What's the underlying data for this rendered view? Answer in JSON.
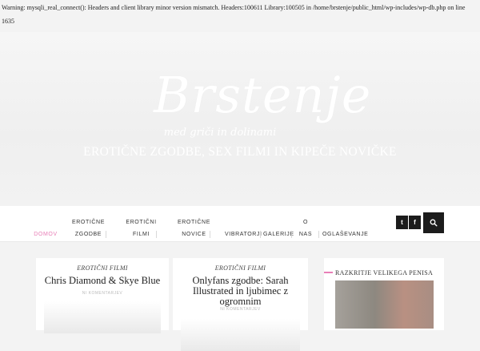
{
  "warning_text": "Warning: mysqli_real_connect(): Headers and client library minor version mismatch. Headers:100611 Library:100505 in /home/brstenje/public_html/wp-includes/wp-db.php on line 1635",
  "site": {
    "logo": "Brstenje",
    "tagline_script": "med griči in dolinami",
    "tagline": "EROTIČNE ZGODBE, SEX FILMI IN KIPEČE NOVIČKE"
  },
  "nav": {
    "items": [
      {
        "line1": "DOMOV",
        "line2": ""
      },
      {
        "line1": "EROTIČNE",
        "line2": "ZGODBE"
      },
      {
        "line1": "EROTIČNI",
        "line2": "FILMI"
      },
      {
        "line1": "EROTIČNE",
        "line2": "NOVICE"
      },
      {
        "line1": "VIBRATORJI",
        "line2": ""
      },
      {
        "line1": "GALERIJE",
        "line2": ""
      },
      {
        "line1": "O",
        "line2": "NAS"
      },
      {
        "line1": "OGLAŠEVANJE",
        "line2": ""
      }
    ],
    "social": [
      {
        "icon": "twitter-icon",
        "glyph": "t"
      },
      {
        "icon": "facebook-icon",
        "glyph": "f"
      }
    ],
    "search_icon": "search-icon",
    "active_color": "#e87fb7"
  },
  "posts": [
    {
      "category": "EROTIČNI FILMI",
      "title": "Chris Diamond & Skye Blue",
      "meta": "NI KOMENTARJEV"
    },
    {
      "category": "EROTIČNI FILMI",
      "title": "Onlyfans zgodbe: Sarah Illustrated in ljubimec z ogromnim",
      "meta": "NI KOMENTARJEV"
    }
  ],
  "sidebar": {
    "widget_title": "RAZKRITJE VELIKEGA PENISA"
  }
}
